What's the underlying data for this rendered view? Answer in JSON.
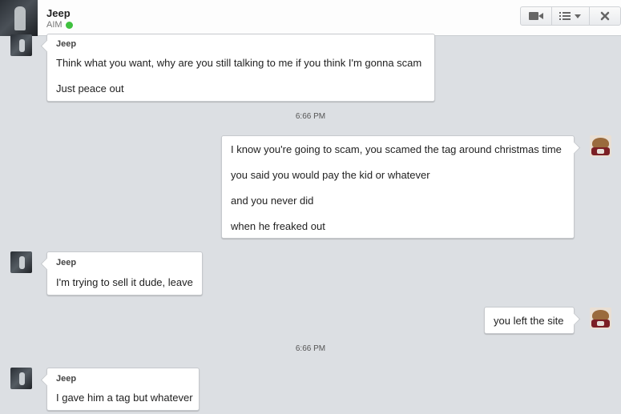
{
  "header": {
    "contact_name": "Jeep",
    "status": "AIM",
    "status_color": "#3fc13f",
    "buttons": [
      "video-call",
      "options-menu",
      "close"
    ]
  },
  "messages": [
    {
      "sender": "Jeep",
      "lines": [
        "Think what you want, why are you still talking to me if you think I'm gonna scam",
        "Just peace out"
      ]
    },
    {
      "timestamp": "6:66 PM"
    },
    {
      "sender": "me",
      "lines": [
        "I know you're going to scam, you scamed the tag around christmas time",
        "you said you would pay the kid or whatever",
        "and you never did",
        "when he freaked out"
      ]
    },
    {
      "sender": "Jeep",
      "lines": [
        "I'm trying to sell it dude, leave"
      ]
    },
    {
      "sender": "me",
      "lines": [
        "you left the site"
      ]
    },
    {
      "timestamp": "6:66 PM"
    },
    {
      "sender": "Jeep",
      "lines": [
        "I gave him a tag but whatever"
      ]
    }
  ]
}
